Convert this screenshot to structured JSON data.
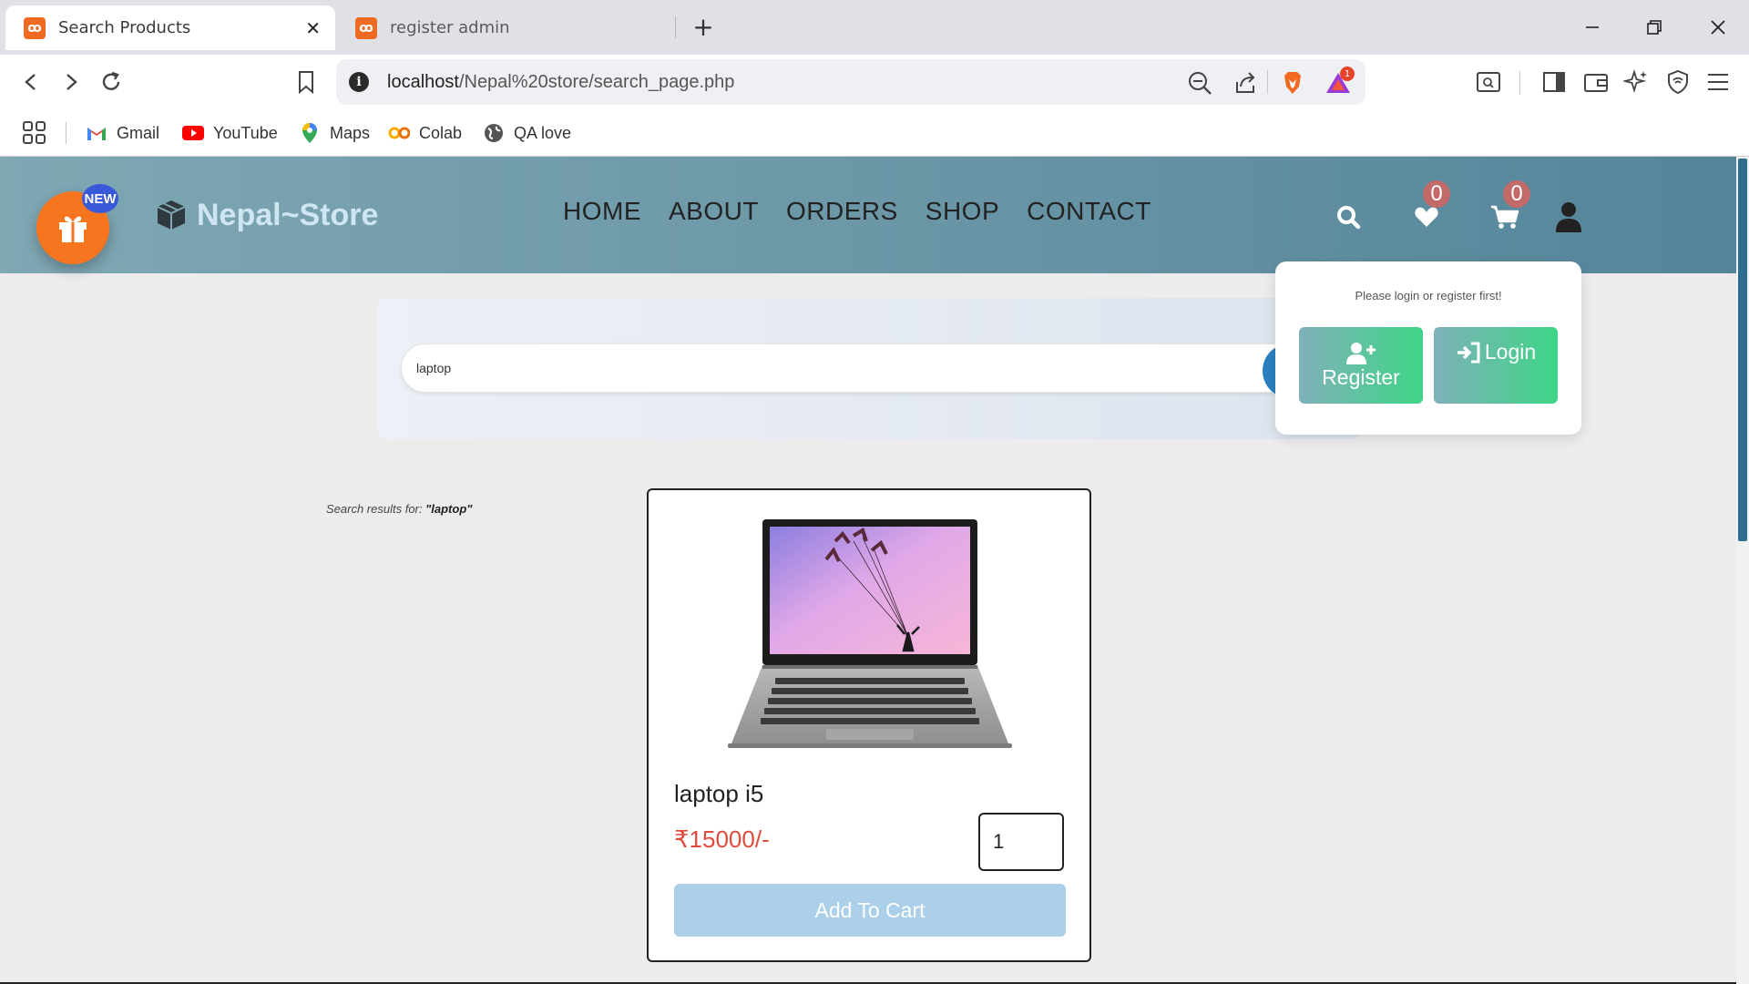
{
  "browser": {
    "tabs": [
      {
        "title": "Search Products",
        "active": true
      },
      {
        "title": "register admin",
        "active": false
      }
    ],
    "new_tab_label": "+",
    "address": {
      "url_host": "localhost",
      "url_path": "/Nepal%20store/search_page.php"
    },
    "rewards_count": "1",
    "bookmarks": [
      {
        "label": "Gmail",
        "icon": "gmail-icon"
      },
      {
        "label": "YouTube",
        "icon": "youtube-icon"
      },
      {
        "label": "Maps",
        "icon": "maps-icon"
      },
      {
        "label": "Colab",
        "icon": "colab-icon"
      },
      {
        "label": "QA love",
        "icon": "globe-icon"
      }
    ]
  },
  "site": {
    "gift_badge": "NEW",
    "brand": "Nepal~Store",
    "nav": [
      "HOME",
      "ABOUT",
      "ORDERS",
      "SHOP",
      "CONTACT"
    ],
    "wishlist_count": "0",
    "cart_count": "0",
    "account_popup": {
      "message": "Please login or register first!",
      "register_label": "Register",
      "login_label": "Login"
    },
    "search": {
      "value": "laptop"
    },
    "results_prefix": "Search results for: ",
    "results_query": "\"laptop\"",
    "products": [
      {
        "name": "laptop i5",
        "price": "₹15000/-",
        "quantity": "1",
        "add_label": "Add To Cart"
      }
    ]
  },
  "colors": {
    "header_gradient_start": "#7fa7b4",
    "header_gradient_end": "#55859a",
    "gift_orange": "#f7751e",
    "price_red": "#e04b3b",
    "add_to_cart_bg": "#acd0e9",
    "popup_button_gradient_end": "#3ed586"
  }
}
